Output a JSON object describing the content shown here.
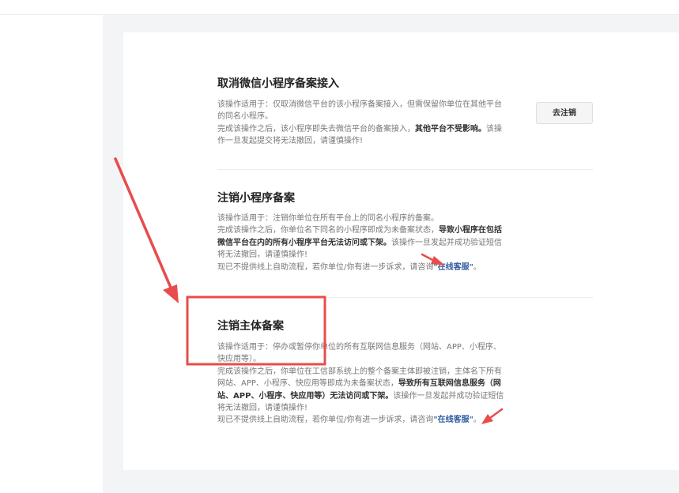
{
  "sections": [
    {
      "title": "取消微信小程序备案接入",
      "lines": [
        "该操作适用于：仅取消微信平台的该小程序备案接入，但需保留你单位在其他平台的同名小程序。",
        "完成该操作之后，该小程序即失去微信平台的备案接入，",
        "其他平台不受影响。",
        "该操作一旦发起提交将无法撤回，请谨慎操作!"
      ],
      "button": "去注销"
    },
    {
      "title": "注销小程序备案",
      "lines": [
        "该操作适用于：注销你单位在所有平台上的同名小程序的备案。",
        "完成该操作之后，你单位名下同名的小程序即成为未备案状态，",
        "导致小程序在包括微信平台在内的所有小程序平台无法访问或下架。",
        "该操作一旦发起并成功验证短信将无法撤回，请谨慎操作!",
        "现已不提供线上自助流程，若你单位/你有进一步诉求，请咨询",
        "\"在线客服\"",
        "。"
      ]
    },
    {
      "title": "注销主体备案",
      "lines": [
        "该操作适用于：停办或暂停你单位的所有互联网信息服务（网站、APP、小程序、快应用等）。",
        "完成该操作之后，你单位在工信部系统上的整个备案主体即被注销，主体名下所有网站、APP、小程序、快应用等即成为未备案状态，",
        "导致所有互联网信息服务（网站、APP、小程序、快应用等）无法访问或下架。",
        "该操作一旦发起并成功验证短信将无法撤回，请谨慎操作!",
        "现已不提供线上自助流程，若你单位/你有进一步诉求，请咨询",
        "\"在线客服\"",
        "。"
      ]
    }
  ],
  "annotation_color": "#e84c4c"
}
